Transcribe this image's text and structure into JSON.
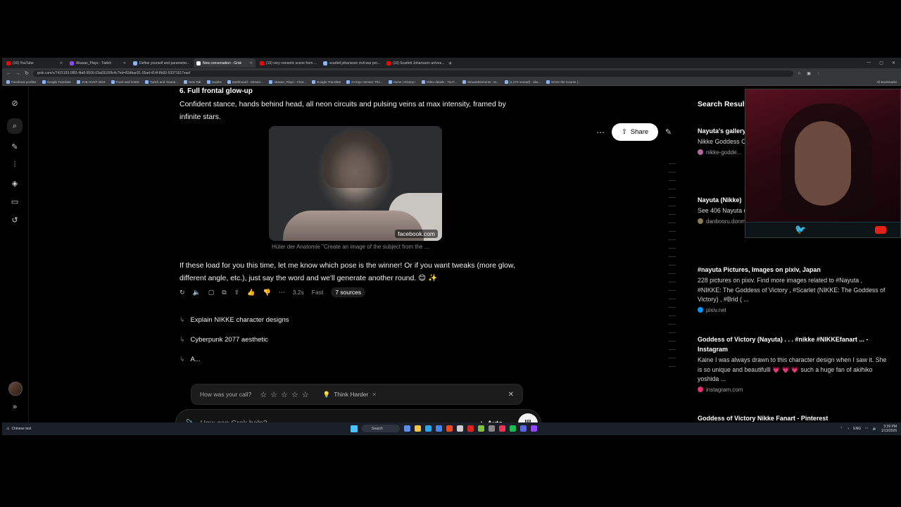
{
  "browser": {
    "tabs": [
      {
        "label": "(10) YouTube",
        "color": "#ff0000",
        "active": false
      },
      {
        "label": "Akasan_Plays - Twitch",
        "color": "#9146ff",
        "active": false
      },
      {
        "label": "Define yourself and parameter...",
        "color": "#8ab4f8",
        "active": false
      },
      {
        "label": "New conversation - Grok",
        "color": "#ffffff",
        "active": true
      },
      {
        "label": "(10) very romantic scene from ...",
        "color": "#ff0000",
        "active": false
      },
      {
        "label": "scarlett johansson civil war pro...",
        "color": "#8ab4f8",
        "active": false
      },
      {
        "label": "(10) Scarlett Johansson arrives...",
        "color": "#ff0000",
        "active": false
      }
    ],
    "url": "grok.com/c/7415193-5f83-4fa8-9506-03a03100fc4c?rid=82dbac91-55ad-414f-8b92-53371617eacf",
    "bookmarks": [
      "Facebook profiles",
      "Google Translate",
      "JOB HUNT 2023",
      "Pools and hotels",
      "Twitch and Youtub...",
      "New Tab",
      "Guides",
      "Dashboard - Stream...",
      "Akasan_Plays - Chat...",
      "Google Translate",
      "O-Hayo Sensei: Tho...",
      "Home | Disney+",
      "Video details - YouT...",
      "StreamElements - M...",
      "(1,470 unread) - aka...",
      "Dimer the Course |..."
    ],
    "all_bookmarks": "All Bookmarks"
  },
  "chat": {
    "heading": "6. Full frontal glow-up",
    "paragraph1": "Confident stance, hands behind head, all neon circuits and pulsing veins at max intensity, framed by infinite stars.",
    "image_source": "facebook.com",
    "image_caption": "Hüter der Anatomie \"Create an image of the subject from the ...",
    "paragraph2": "If these load for you this time, let me know which pose is the winner! Or if you want tweaks (more glow, different angle, etc.), just say the word and we'll generate another round. 😊 ✨",
    "meta_time": "3.2s",
    "meta_mode": "Fast",
    "sources": "7 sources",
    "followups": [
      "Explain NIKKE character designs",
      "Cyberpunk 2077 aesthetic",
      "A..."
    ]
  },
  "feedback": {
    "prompt": "How was your call?",
    "think_harder": "Think Harder"
  },
  "composer": {
    "placeholder": "How can Grok help?",
    "mode": "Auto"
  },
  "header": {
    "share": "Share"
  },
  "results": {
    "title": "Search Results",
    "items": [
      {
        "title": "Nayuta's gallery | Fandom",
        "desc": "Nikke Goddess Community. Vie...",
        "source": "nikke-godde...",
        "color": "#b46aa0"
      },
      {
        "title": "Nayuta (Nikke)",
        "desc": "See 406 Nayuta character in Goo... Pioneer squad.",
        "source": "danbooru.donmai.us",
        "color": "#8a7a5a"
      },
      {
        "title": "#nayuta Pictures, Images on pixiv, Japan",
        "desc": "228 pictures on pixiv. Find more images related to #Nayuta , #NIKKE: The Goddess of Victory , #Scarlet (NIKKE: The Goddess of Victory) , #Brid ( ...",
        "source": "pixiv.net",
        "color": "#0096fa"
      },
      {
        "title": "Goddess of Victory (Nayuta) . . . #nikke #NIKKEfanart ... - Instagram",
        "desc": "Kaine I was always drawn to this character design when I saw it. She is so unique and beautifulll 💗 💗 💗 such a huge fan of akihiko yoshida ...",
        "source": "instagram.com",
        "color": "#e1306c"
      },
      {
        "title": "Goddess of Victory Nikke Fanart - Pinterest",
        "desc": "",
        "source": "",
        "color": "#e60023"
      }
    ]
  },
  "taskbar": {
    "weather": "Chinese text",
    "search": "Search",
    "time": "3:39 PM",
    "date": "1/13/2026",
    "lang": "ENG"
  }
}
